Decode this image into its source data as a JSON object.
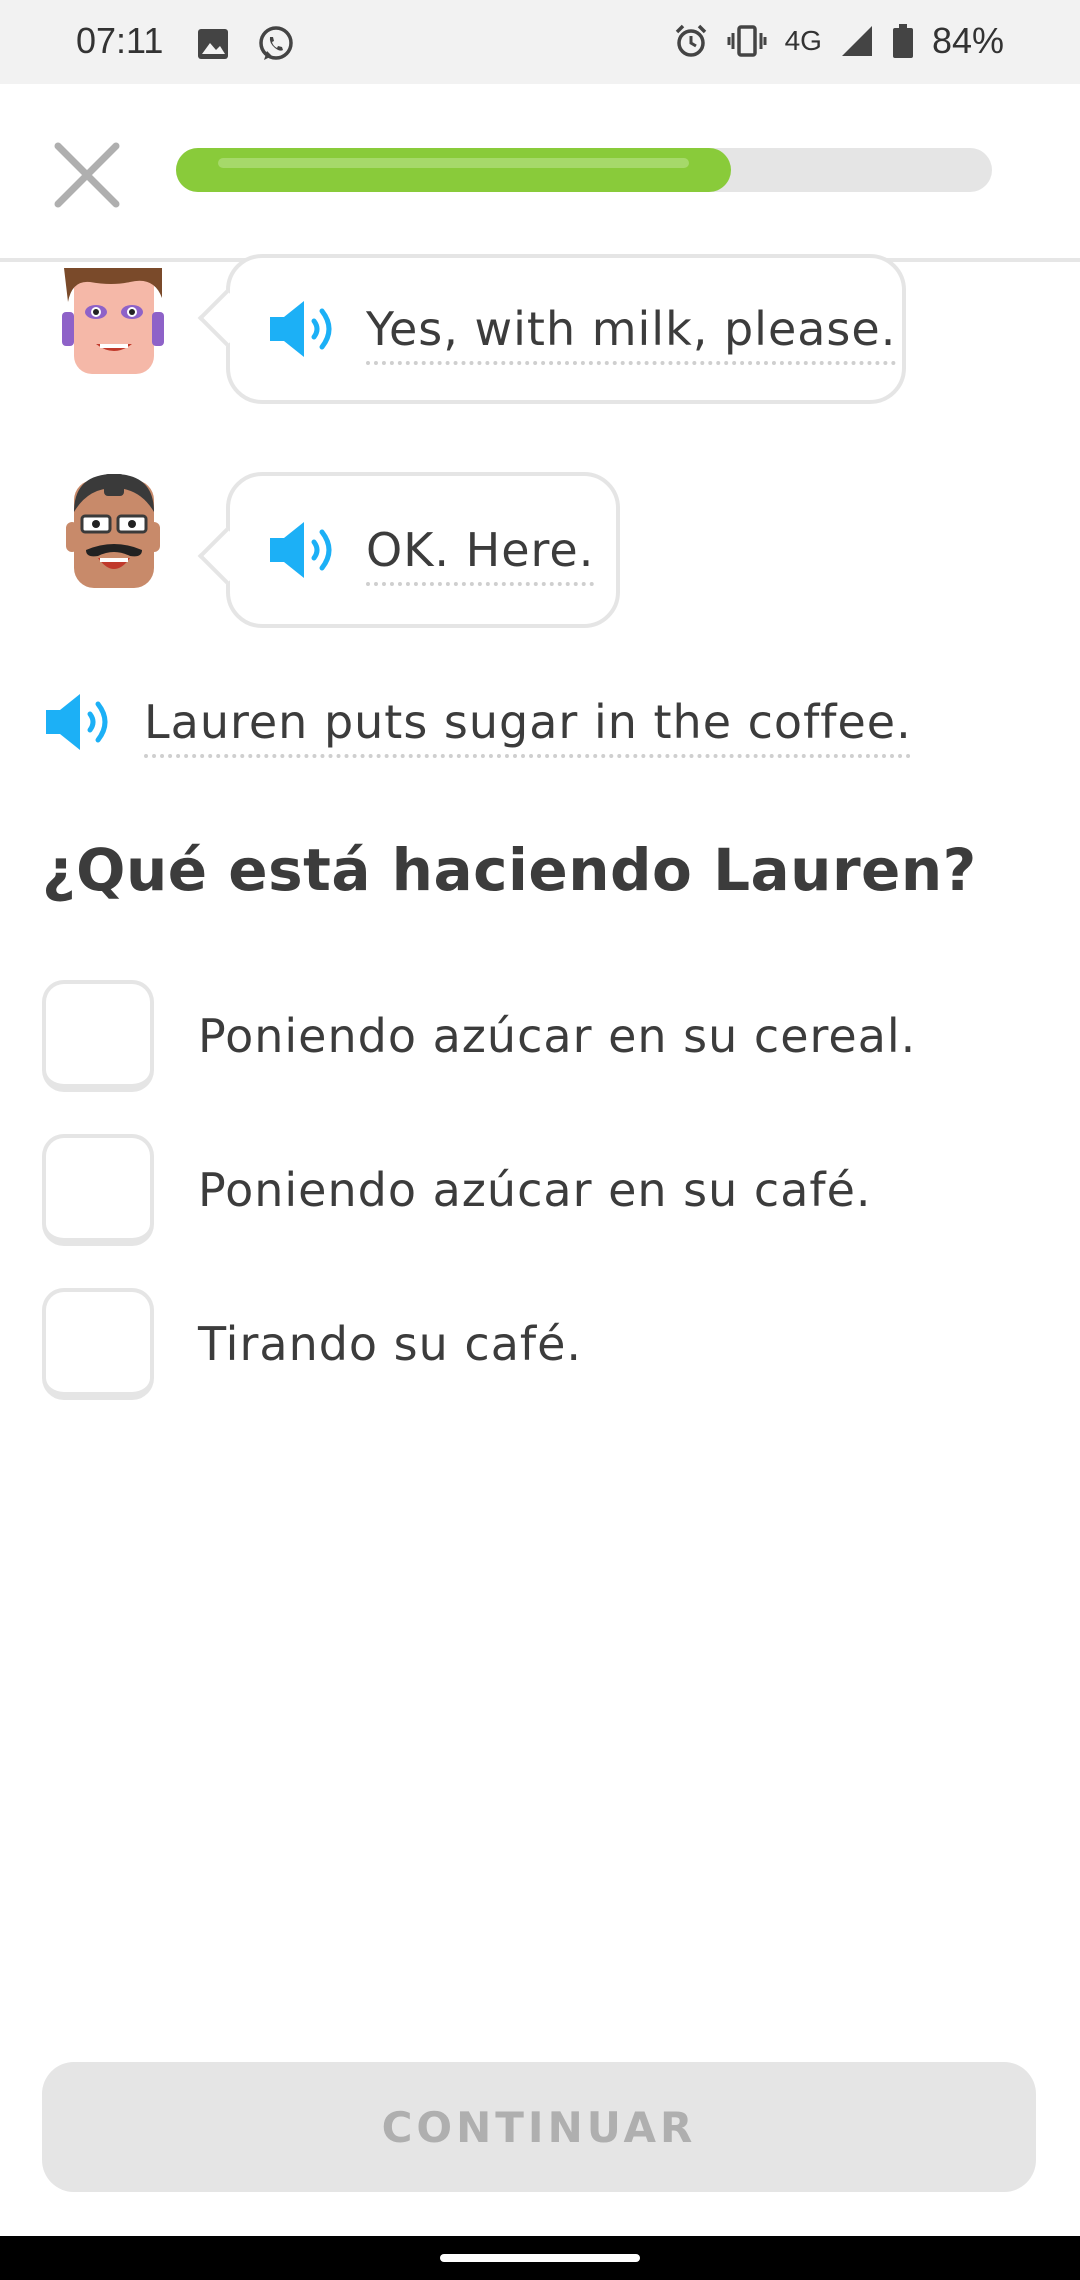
{
  "status_bar": {
    "time": "07:11",
    "network": "4G",
    "battery": "84%",
    "icons": [
      "image-icon",
      "whatsapp-icon",
      "alarm-icon",
      "vibrate-icon",
      "signal-icon",
      "battery-icon"
    ]
  },
  "header": {
    "close_icon": "close-icon",
    "progress_fraction": 0.68
  },
  "dialogue": [
    {
      "speaker": "woman-avatar",
      "text": "Yes, with milk, please."
    },
    {
      "speaker": "man-avatar",
      "text": "OK. Here."
    }
  ],
  "narration": {
    "text": "Lauren puts sugar in the coffee."
  },
  "question": {
    "text": "¿Qué está haciendo Lauren?"
  },
  "options": [
    {
      "label": "Poniendo azúcar en su cereal."
    },
    {
      "label": "Poniendo azúcar en su café."
    },
    {
      "label": "Tirando su café."
    }
  ],
  "footer": {
    "continue_label": "CONTINUAR"
  },
  "colors": {
    "progress": "#89cb3a",
    "speaker": "#1cb0f6",
    "border": "#e5e5e5",
    "text": "#3c3c3c",
    "disabled_button": "#e5e5e5",
    "disabled_text": "#afafaf"
  }
}
